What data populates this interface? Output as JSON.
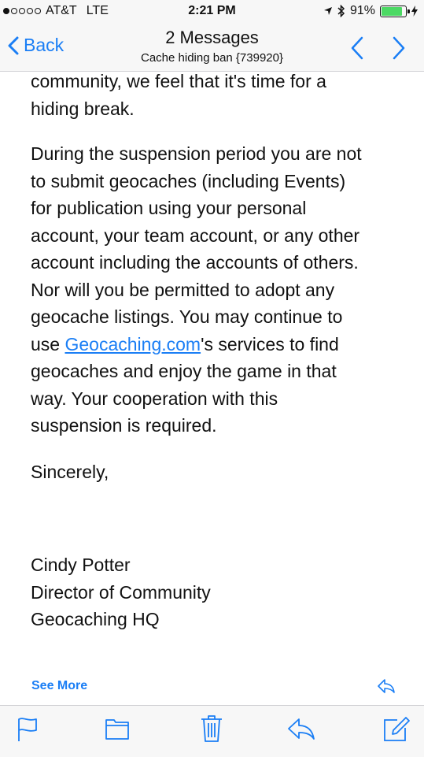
{
  "status_bar": {
    "carrier": "AT&T",
    "network": "LTE",
    "time": "2:21 PM",
    "battery_percent": "91%",
    "battery_level": 0.91,
    "icons": [
      "location-arrow-icon",
      "bluetooth-icon",
      "battery-icon",
      "charging-bolt-icon"
    ]
  },
  "nav": {
    "back_label": "Back",
    "title": "2 Messages",
    "subtitle": "Cache hiding ban {739920}"
  },
  "message": {
    "intro_lines": [
      "community, we feel that it's time for a",
      "hiding break."
    ],
    "suspension_lines_before_link": [
      "During the suspension period you are not",
      "to submit geocaches (including Events)",
      "for publication using your personal",
      "account, your team account, or any other",
      "account including the accounts of others.",
      "Nor will you be permitted to adopt any",
      "geocache listings. You may continue to"
    ],
    "link_prefix": "use ",
    "link_text": "Geocaching.com",
    "link_suffix": "'s services to find",
    "suspension_lines_after_link": [
      "geocaches and enjoy the game in that",
      "way. Your cooperation with this",
      "suspension is required."
    ],
    "closing": "Sincerely,",
    "signature": [
      "Cindy Potter",
      "Director of Community",
      "Geocaching HQ"
    ],
    "see_more": "See More"
  },
  "toolbar": {
    "icons": [
      "flag-icon",
      "folder-icon",
      "trash-icon",
      "reply-icon",
      "compose-icon"
    ]
  },
  "colors": {
    "accent": "#1a7ef5",
    "battery": "#4cd964",
    "background": "#f7f7f7"
  }
}
